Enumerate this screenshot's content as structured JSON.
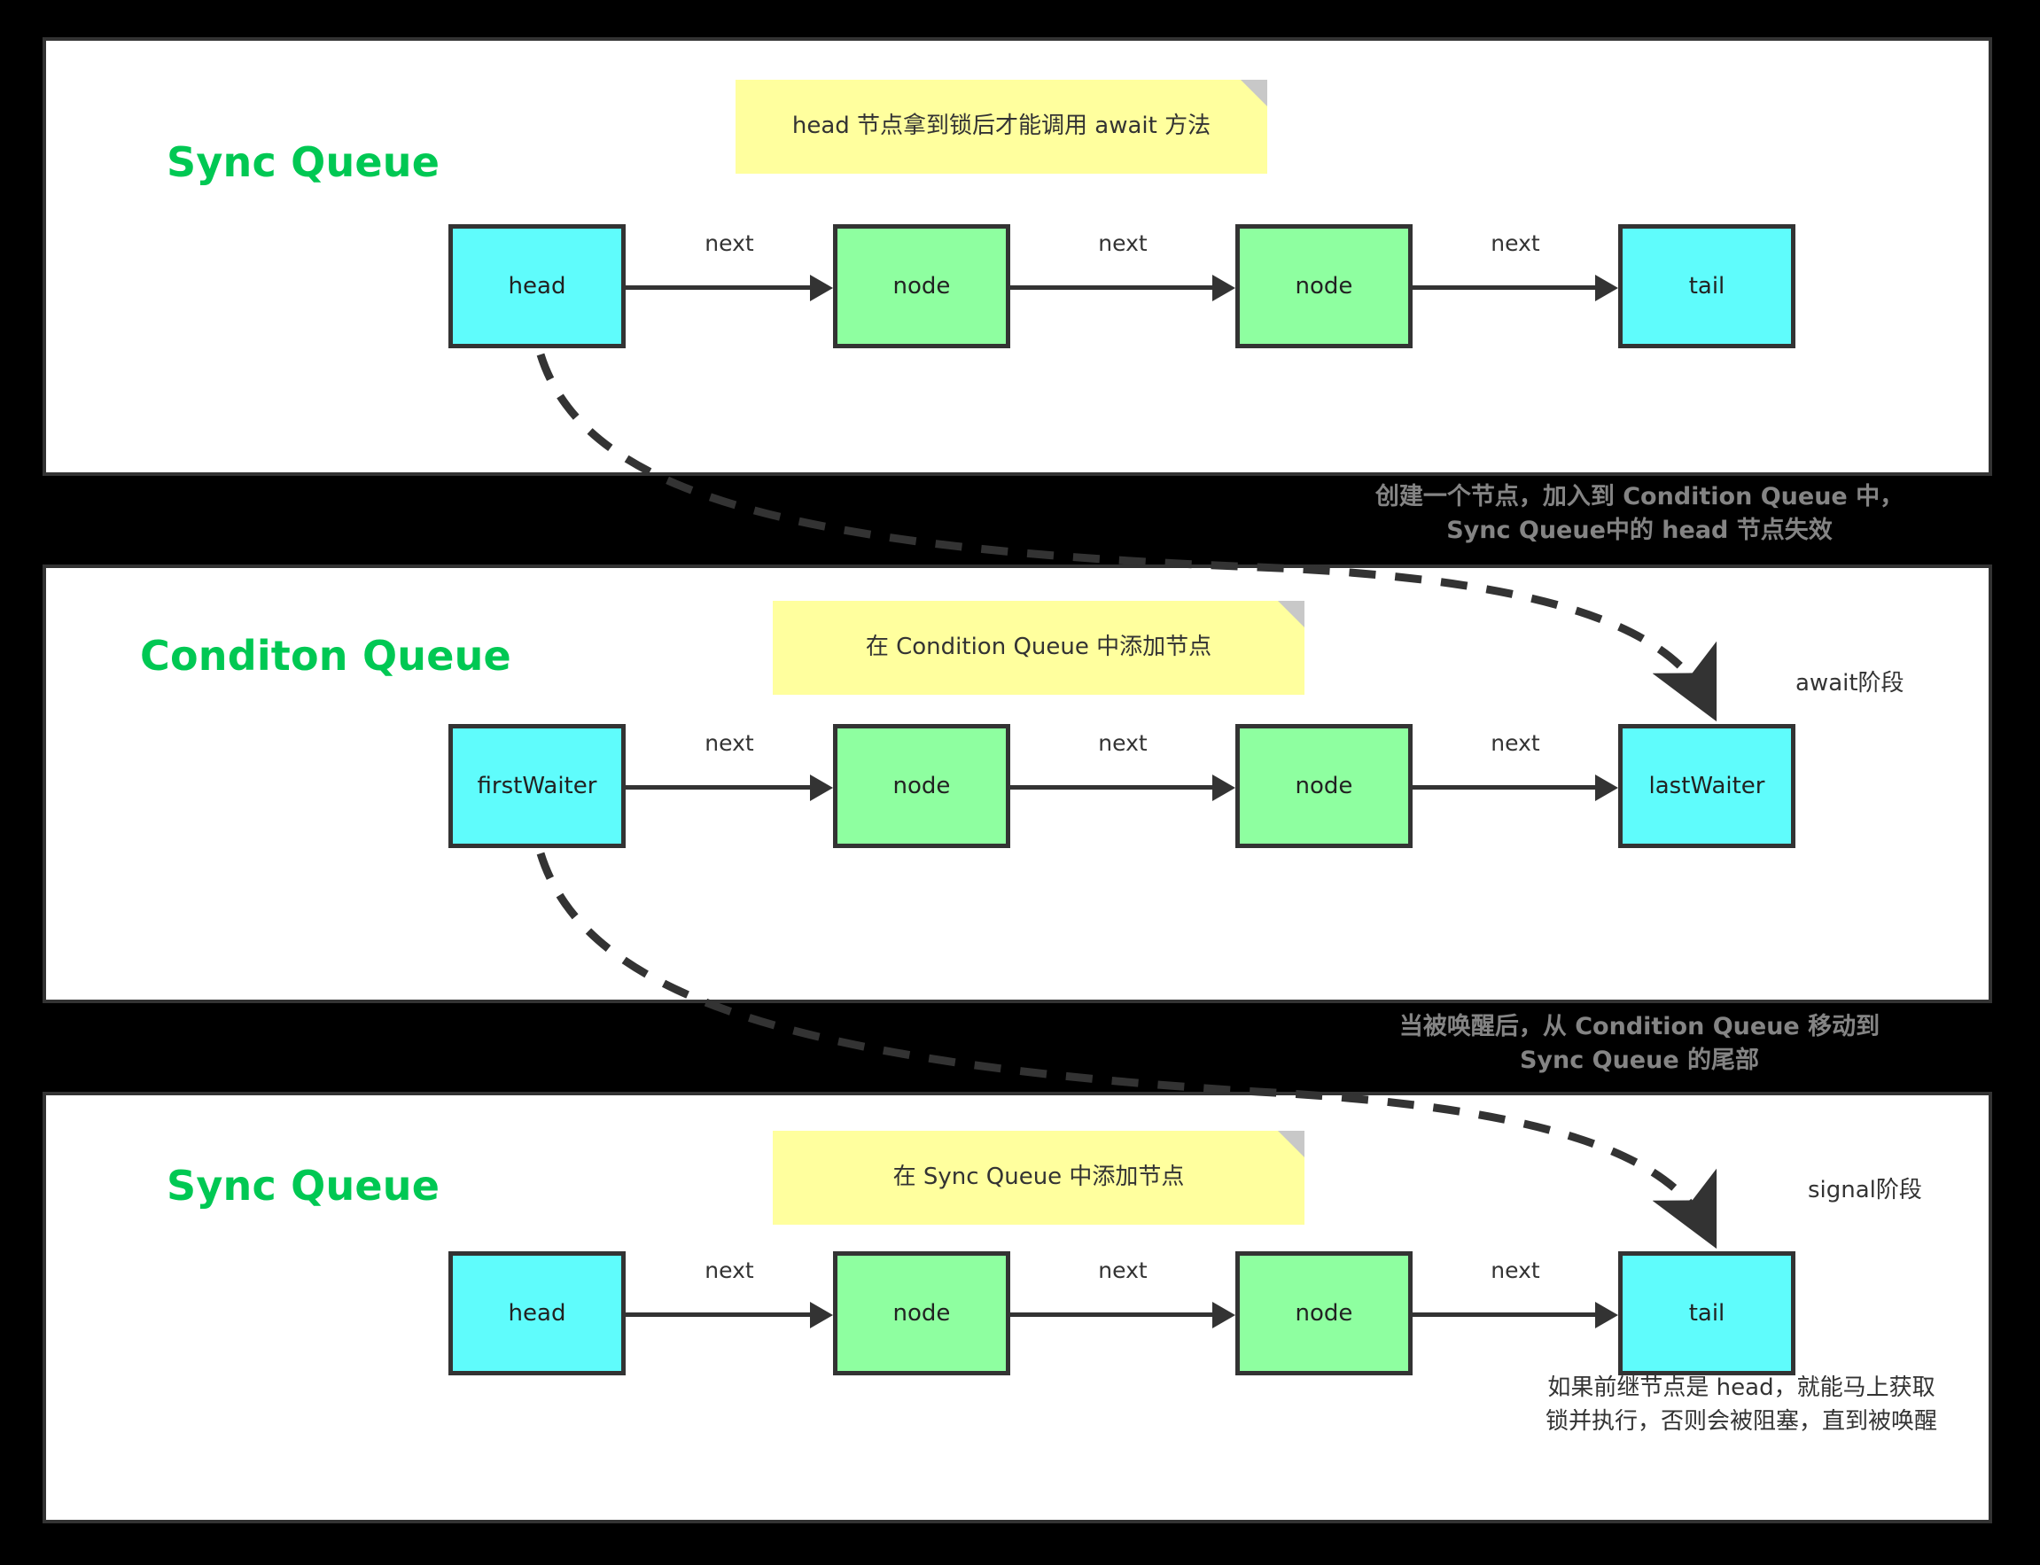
{
  "sections": [
    {
      "id": "sync-queue-top",
      "title": "Sync Queue",
      "sticky_note": "head 节点拿到锁后才能调用 await 方法",
      "nodes": [
        "head",
        "node",
        "node",
        "tail"
      ],
      "node_colors": [
        "cyan",
        "green",
        "green",
        "cyan"
      ],
      "edge_labels": [
        "next",
        "next",
        "next"
      ]
    },
    {
      "id": "condition-queue",
      "title": "Conditon Queue",
      "sticky_note": "在 Condition Queue 中添加节点",
      "nodes": [
        "firstWaiter",
        "node",
        "node",
        "lastWaiter"
      ],
      "node_colors": [
        "cyan",
        "green",
        "green",
        "cyan"
      ],
      "edge_labels": [
        "next",
        "next",
        "next"
      ],
      "phase_label": "await阶段"
    },
    {
      "id": "sync-queue-bottom",
      "title": "Sync Queue",
      "sticky_note": "在 Sync Queue 中添加节点",
      "nodes": [
        "head",
        "node",
        "node",
        "tail"
      ],
      "node_colors": [
        "cyan",
        "green",
        "green",
        "cyan"
      ],
      "edge_labels": [
        "next",
        "next",
        "next"
      ],
      "phase_label": "signal阶段"
    }
  ],
  "transitions": [
    {
      "id": "await-transition",
      "text": "创建一个节点，加入到 Condition Queue 中，\nSync Queue中的 head 节点失效"
    },
    {
      "id": "signal-transition",
      "text": "当被唤醒后，从 Condition Queue 移动到\nSync Queue 的尾部"
    }
  ],
  "bottom_caption": "如果前继节点是 head，就能马上获取\n锁并执行，否则会被阻塞，直到被唤醒",
  "colors": {
    "background": "#000000",
    "panel": "#ffffff",
    "title_green": "#00c853",
    "sticky_yellow": "#ffff9e",
    "sticky_fold": "#c8c8c8",
    "node_cyan": "#5ffcfc",
    "node_green": "#8effa0",
    "stroke_dark": "#333333",
    "gray_note": "#848484"
  }
}
